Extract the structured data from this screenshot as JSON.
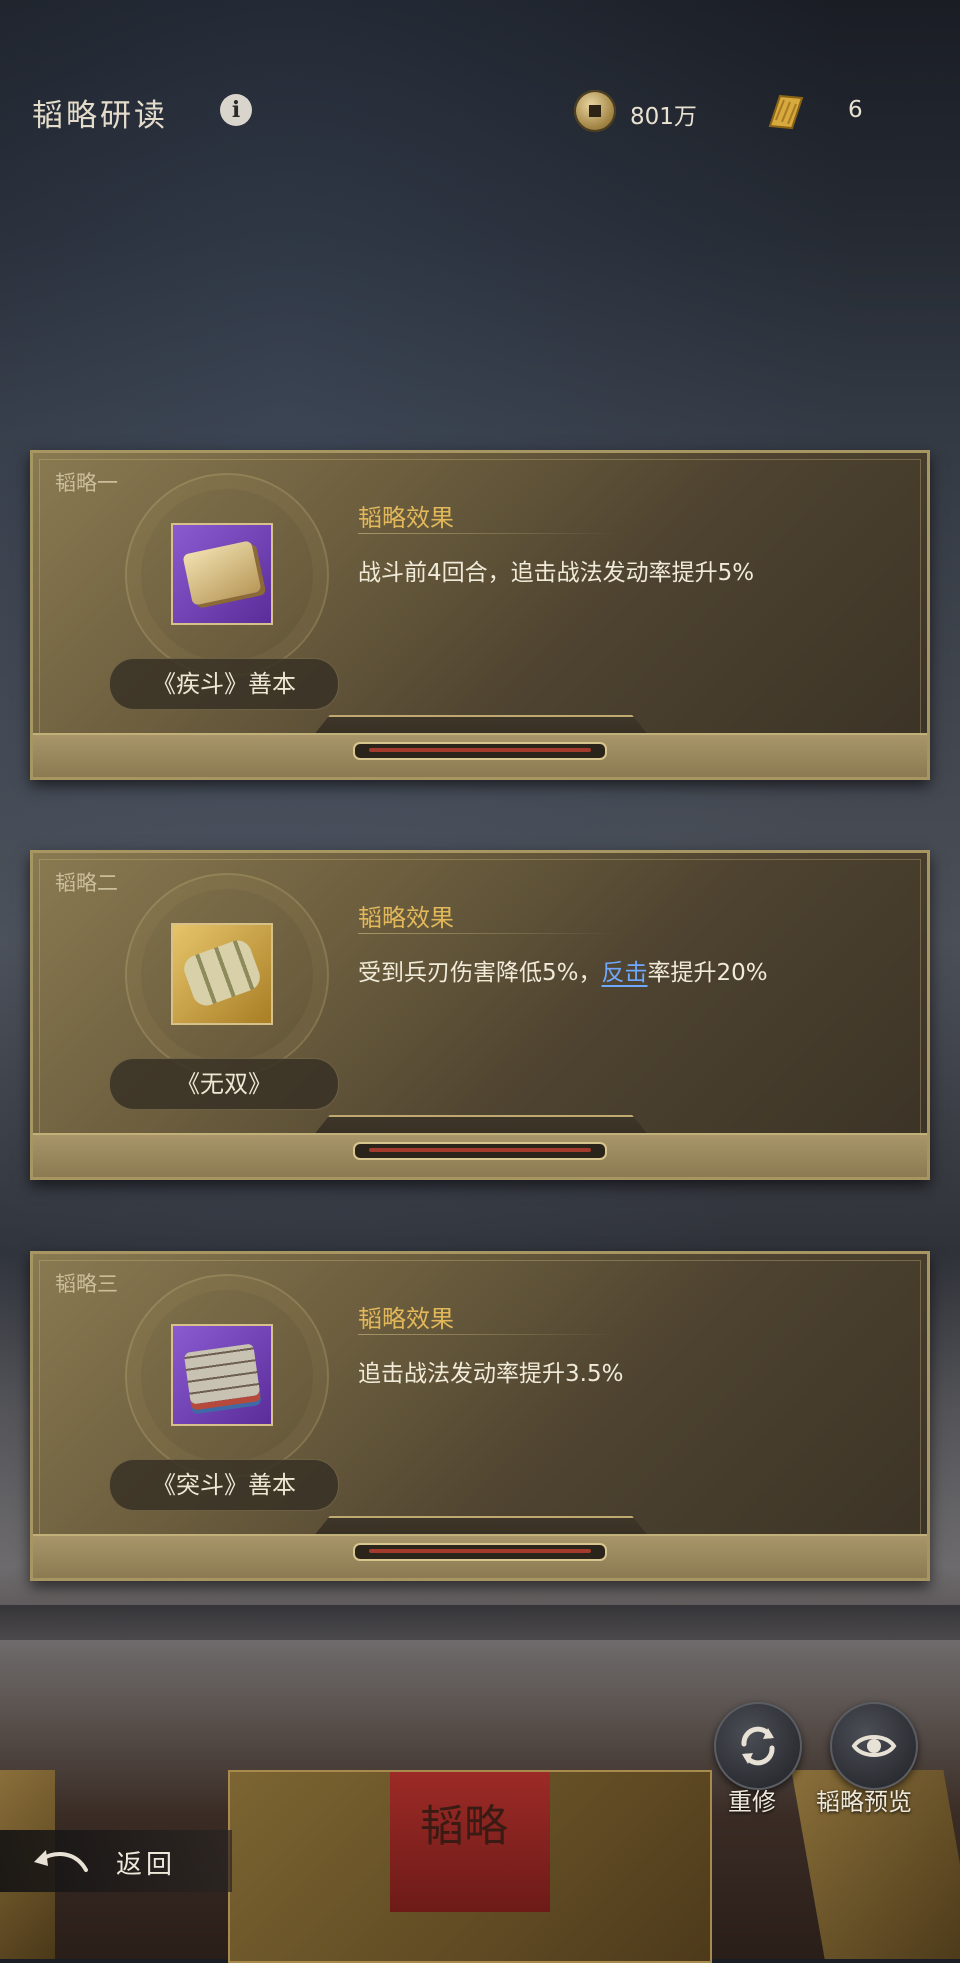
{
  "header": {
    "title": "韬略研读",
    "info_icon": "info-icon",
    "coins": "801万",
    "scrolls": "6"
  },
  "cards": [
    {
      "label": "韬略一",
      "name": "《疾斗》善本",
      "effect_title": "韬略效果",
      "effect_text": "战斗前4回合，追击战法发动率提升5%",
      "icon": "scroll-book-icon",
      "rarity_color": "#7c4cc4",
      "progress": 1.0
    },
    {
      "label": "韬略二",
      "name": "《无双》",
      "effect_title": "韬略效果",
      "effect_text_pre": "受到兵刃伤害降低5%，",
      "effect_link": "反击",
      "effect_text_post": "率提升20%",
      "icon": "scroll-rolls-icon",
      "rarity_color": "#c99a3a",
      "progress": 1.0
    },
    {
      "label": "韬略三",
      "name": "《突斗》善本",
      "effect_title": "韬略效果",
      "effect_text": "追击战法发动率提升3.5%",
      "icon": "book-stack-icon",
      "rarity_color": "#7c4cc4",
      "progress": 1.0
    }
  ],
  "actions": {
    "retrain": "重修",
    "preview": "韬略预览",
    "back": "返回"
  },
  "decor": {
    "book_glyph": "韬略"
  }
}
